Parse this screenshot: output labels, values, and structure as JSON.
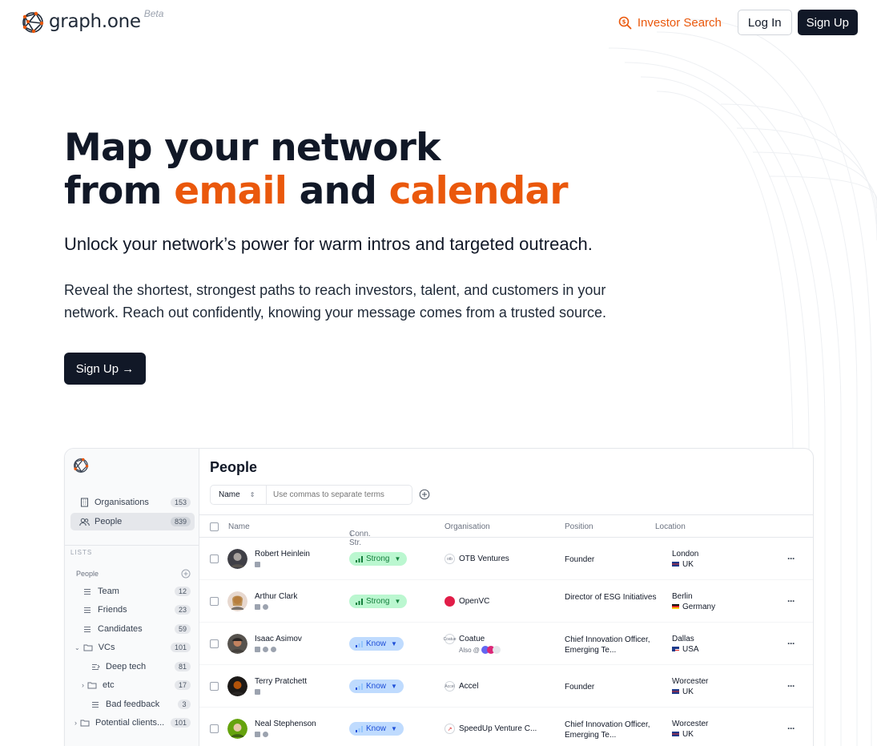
{
  "header": {
    "logo_text": "graph.one",
    "logo_badge": "Beta",
    "investor_search": "Investor Search",
    "login": "Log In",
    "signup": "Sign Up"
  },
  "hero": {
    "title_line1": "Map your network",
    "title_from": "from ",
    "title_email": "email",
    "title_and": " and ",
    "title_calendar": "calendar",
    "subtitle": "Unlock your network’s power for warm intros and targeted outreach.",
    "description": "Reveal the shortest, strongest paths to reach investors, talent, and customers in your network. Reach out confidently, knowing your message comes from a trusted source.",
    "cta": "Sign Up →"
  },
  "colors": {
    "accent": "#ea580c",
    "dark": "#111827",
    "strong_bg": "#bbf7d0",
    "know_bg": "#bfdbfe"
  },
  "app": {
    "sidebar": {
      "organisations": {
        "label": "Organisations",
        "count": "153"
      },
      "people": {
        "label": "People",
        "count": "839"
      },
      "lists_heading": "LISTS",
      "people_group": "People",
      "items": [
        {
          "label": "Team",
          "count": "12",
          "icon": "list-icon"
        },
        {
          "label": "Friends",
          "count": "23",
          "icon": "list-icon"
        },
        {
          "label": "Candidates",
          "count": "59",
          "icon": "list-icon"
        },
        {
          "label": "VCs",
          "count": "101",
          "icon": "folder-icon"
        },
        {
          "label": "Deep tech",
          "count": "81",
          "icon": "filter-list-icon"
        },
        {
          "label": "etc",
          "count": "17",
          "icon": "folder-icon"
        },
        {
          "label": "Bad feedback",
          "count": "3",
          "icon": "list-icon"
        },
        {
          "label": "Potential clients...",
          "count": "101",
          "icon": "folder-icon"
        }
      ]
    },
    "main": {
      "title": "People",
      "filter_field": "Name",
      "filter_placeholder": "Use commas to separate terms",
      "columns": {
        "name": "Name",
        "strength": "Conn. Str.",
        "organisation": "Organisation",
        "position": "Position",
        "location": "Location"
      },
      "rows": [
        {
          "name": "Robert Heinlein",
          "strength": "Strong",
          "org": "OTB Ventures",
          "org_logo": "otb",
          "position": "Founder",
          "city": "London",
          "country": "UK"
        },
        {
          "name": "Arthur Clark",
          "strength": "Strong",
          "org": "OpenVC",
          "org_logo": "",
          "position": "Director of ESG Initiatives",
          "city": "Berlin",
          "country": "Germany"
        },
        {
          "name": "Isaac Asimov",
          "strength": "Know",
          "org": "Coatue",
          "org_logo": "Coatue",
          "org_sub": "Also @",
          "position": "Chief Innovation Officer, Emerging Te...",
          "city": "Dallas",
          "country": "USA"
        },
        {
          "name": "Terry Pratchett",
          "strength": "Know",
          "org": "Accel",
          "org_logo": "Accel",
          "position": "Founder",
          "city": "Worcester",
          "country": "UK"
        },
        {
          "name": "Neal Stephenson",
          "strength": "Know",
          "org": "SpeedUp Venture C...",
          "org_logo": "",
          "position": "Chief Innovation Officer, Emerging Te...",
          "city": "Worcester",
          "country": "UK"
        }
      ],
      "more": "···"
    }
  }
}
